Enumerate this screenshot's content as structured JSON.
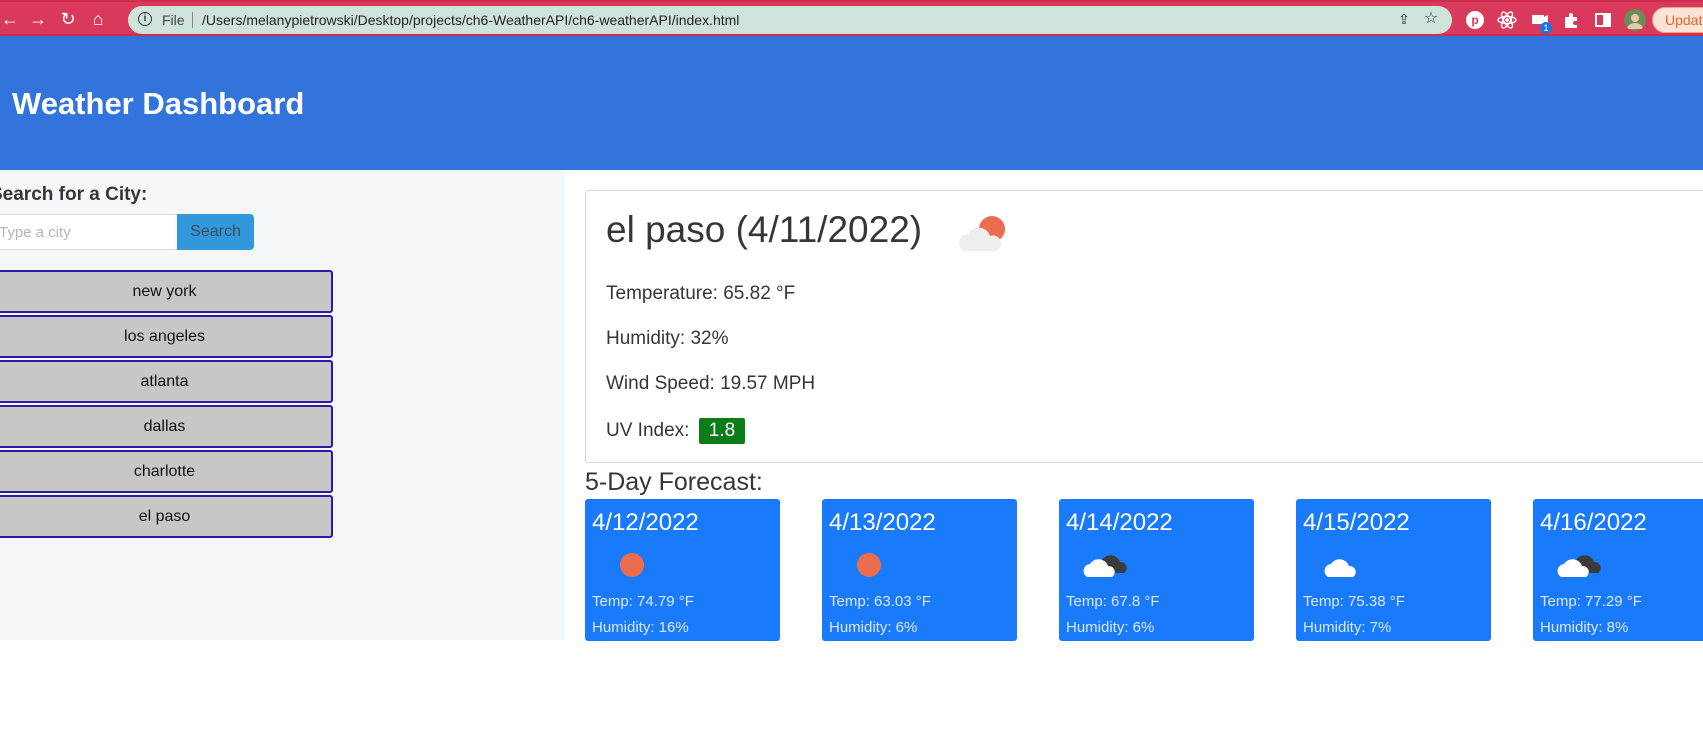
{
  "browser": {
    "file_label": "File",
    "url": "/Users/melanypietrowski/Desktop/projects/ch6-WeatherAPI/ch6-weatherAPI/index.html",
    "update_label": "Updat",
    "ext_badge": "1"
  },
  "header": {
    "title": "Weather Dashboard"
  },
  "search": {
    "label": "Search for a City:",
    "placeholder": "Type a city",
    "button_label": "Search"
  },
  "history": [
    "new york",
    "los angeles",
    "atlanta",
    "dallas",
    "charlotte",
    "el paso"
  ],
  "current": {
    "title": "el paso (4/11/2022)",
    "icon": "partly-cloudy-sun-icon",
    "temperature": "Temperature: 65.82 °F",
    "humidity": "Humidity: 32%",
    "wind": "Wind Speed: 19.57 MPH",
    "uv_label": "UV Index:",
    "uv_value": "1.8",
    "uv_color": "#0a7d19"
  },
  "forecast": {
    "title": "5-Day Forecast:",
    "days": [
      {
        "date": "4/12/2022",
        "icon": "sun-icon",
        "temp": "Temp: 74.79 °F",
        "humidity": "Humidity: 16%"
      },
      {
        "date": "4/13/2022",
        "icon": "sun-icon",
        "temp": "Temp: 63.03 °F",
        "humidity": "Humidity: 6%"
      },
      {
        "date": "4/14/2022",
        "icon": "broken-clouds-icon",
        "temp": "Temp: 67.8 °F",
        "humidity": "Humidity: 6%"
      },
      {
        "date": "4/15/2022",
        "icon": "cloud-icon",
        "temp": "Temp: 75.38 °F",
        "humidity": "Humidity: 7%"
      },
      {
        "date": "4/16/2022",
        "icon": "broken-clouds-icon",
        "temp": "Temp: 77.29 °F",
        "humidity": "Humidity: 8%"
      }
    ]
  },
  "colors": {
    "header_bg": "#3273dc",
    "forecast_card_bg": "#1a7afc",
    "city_button_border": "#2a1ba8",
    "search_button_bg": "#3298dc"
  }
}
